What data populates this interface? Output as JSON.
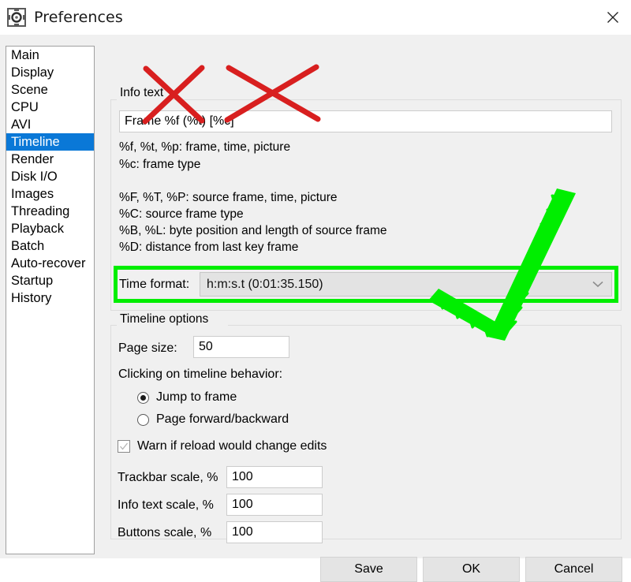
{
  "window": {
    "title": "Preferences",
    "app_icon": "gear-icon",
    "close_icon": "close-icon"
  },
  "sidebar": {
    "selected": "Timeline",
    "items": [
      {
        "label": "Main"
      },
      {
        "label": "Display"
      },
      {
        "label": "Scene"
      },
      {
        "label": "CPU"
      },
      {
        "label": "AVI"
      },
      {
        "label": "Timeline"
      },
      {
        "label": "Render"
      },
      {
        "label": "Disk I/O"
      },
      {
        "label": "Images"
      },
      {
        "label": "Threading"
      },
      {
        "label": "Playback"
      },
      {
        "label": "Batch"
      },
      {
        "label": "Auto-recover"
      },
      {
        "label": "Startup"
      },
      {
        "label": "History"
      }
    ]
  },
  "info_group": {
    "title": "Info text",
    "textbox_value": "Frame %f (%t) [%c]",
    "help_lines": [
      "%f, %t, %p: frame, time, picture",
      "%c: frame type",
      "%F, %T, %P: source frame, time, picture",
      "%C: source frame type",
      "%B, %L: byte position and length of source frame",
      "%D: distance from last key frame"
    ],
    "time_format_label": "Time format:",
    "time_format_value": "h:m:s.t (0:01:35.150)",
    "time_format_arrow": "chevron-down-icon"
  },
  "timeline_group": {
    "title": "Timeline options",
    "page_size_label": "Page size:",
    "page_size_value": "50",
    "behavior_label": "Clicking on timeline behavior:",
    "radio_jump_label": "Jump to frame",
    "radio_page_label": "Page forward/backward",
    "radio_selected": "Jump to frame",
    "warn_label": "Warn if reload would change edits",
    "warn_checked": true,
    "trackbar_label": "Trackbar scale, %",
    "trackbar_value": "100",
    "infotext_label": "Info text scale, %",
    "infotext_value": "100",
    "buttons_label": "Buttons scale, %",
    "buttons_value": "100"
  },
  "footer": {
    "save_label": "Save",
    "ok_label": "OK",
    "cancel_label": "Cancel"
  },
  "annotations": {
    "cross_color": "#d81f1f",
    "check_color": "#00ee00",
    "highlight_color": "#00ee00",
    "marks": [
      "red-cross-1",
      "red-cross-2",
      "green-checkmark",
      "green-highlight-box"
    ]
  },
  "colors": {
    "selection_blue": "#0a78d7",
    "dialog_background": "#f0f0f0",
    "titlebar_background": "#ffffff"
  }
}
